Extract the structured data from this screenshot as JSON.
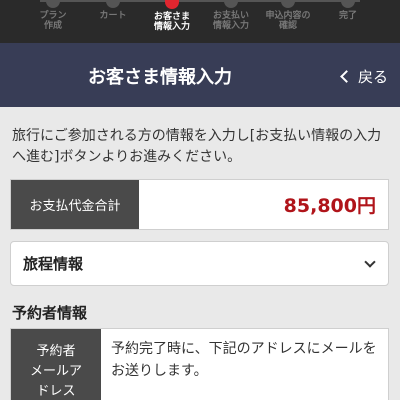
{
  "steps": [
    {
      "label": "プラン\n作成",
      "active": false
    },
    {
      "label": "カート",
      "active": false
    },
    {
      "label": "お客さま\n情報入力",
      "active": true
    },
    {
      "label": "お支払い\n情報入力",
      "active": false
    },
    {
      "label": "申込内容の\n確認",
      "active": false
    },
    {
      "label": "完了",
      "active": false
    }
  ],
  "header": {
    "title": "お客さま情報入力",
    "back_label": "戻る"
  },
  "intro": "旅行にご参加される方の情報を入力し[お支払い情報の入力へ進む]ボタンよりお進みください。",
  "total": {
    "label": "お支払代金合計",
    "amount": "85,800円"
  },
  "itinerary": {
    "label": "旅程情報"
  },
  "booker": {
    "heading": "予約者情報",
    "email_label": "予約者\nメールア\nドレス",
    "email_note": "予約完了時に、下記のアドレスにメールをお送りします。"
  },
  "colors": {
    "accent": "#e0262f",
    "header_bg": "#383d56",
    "price": "#b0141a",
    "label_bg": "#4a4a4a"
  }
}
